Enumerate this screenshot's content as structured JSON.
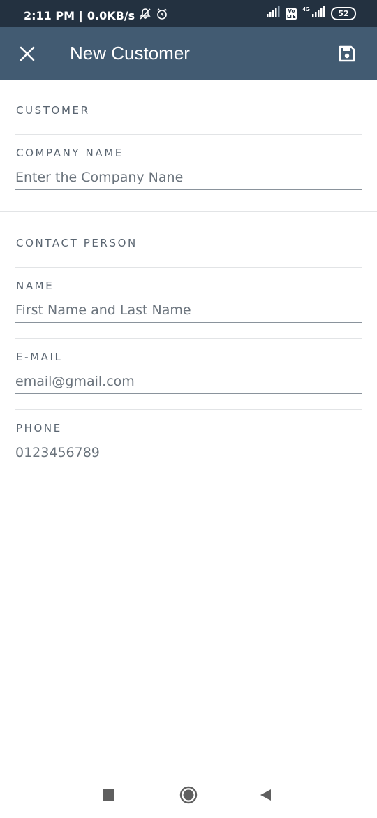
{
  "status_bar": {
    "time": "2:11 PM",
    "speed": "0.0KB/s",
    "network_label": "4G",
    "volte_label": "Vo LTE",
    "battery": "52",
    "icons": [
      "mute-icon",
      "alarm-icon",
      "signal-icon",
      "volte-icon",
      "signal-icon",
      "battery-icon"
    ]
  },
  "header": {
    "title": "New Customer",
    "close_icon": "close-icon",
    "save_icon": "save-icon",
    "background": "#425b72"
  },
  "form": {
    "customer_section": "CUSTOMER",
    "company_name": {
      "label": "COMPANY NAME",
      "placeholder": "Enter the Company Nane",
      "value": ""
    },
    "contact_section": "CONTACT PERSON",
    "name": {
      "label": "NAME",
      "placeholder": "First Name and Last Name",
      "value": ""
    },
    "email": {
      "label": "E-MAIL",
      "placeholder": "email@gmail.com",
      "value": ""
    },
    "phone": {
      "label": "PHONE",
      "placeholder": "0123456789",
      "value": ""
    }
  },
  "nav_bar": {
    "icons": [
      "recents-icon",
      "home-icon",
      "back-icon"
    ]
  }
}
